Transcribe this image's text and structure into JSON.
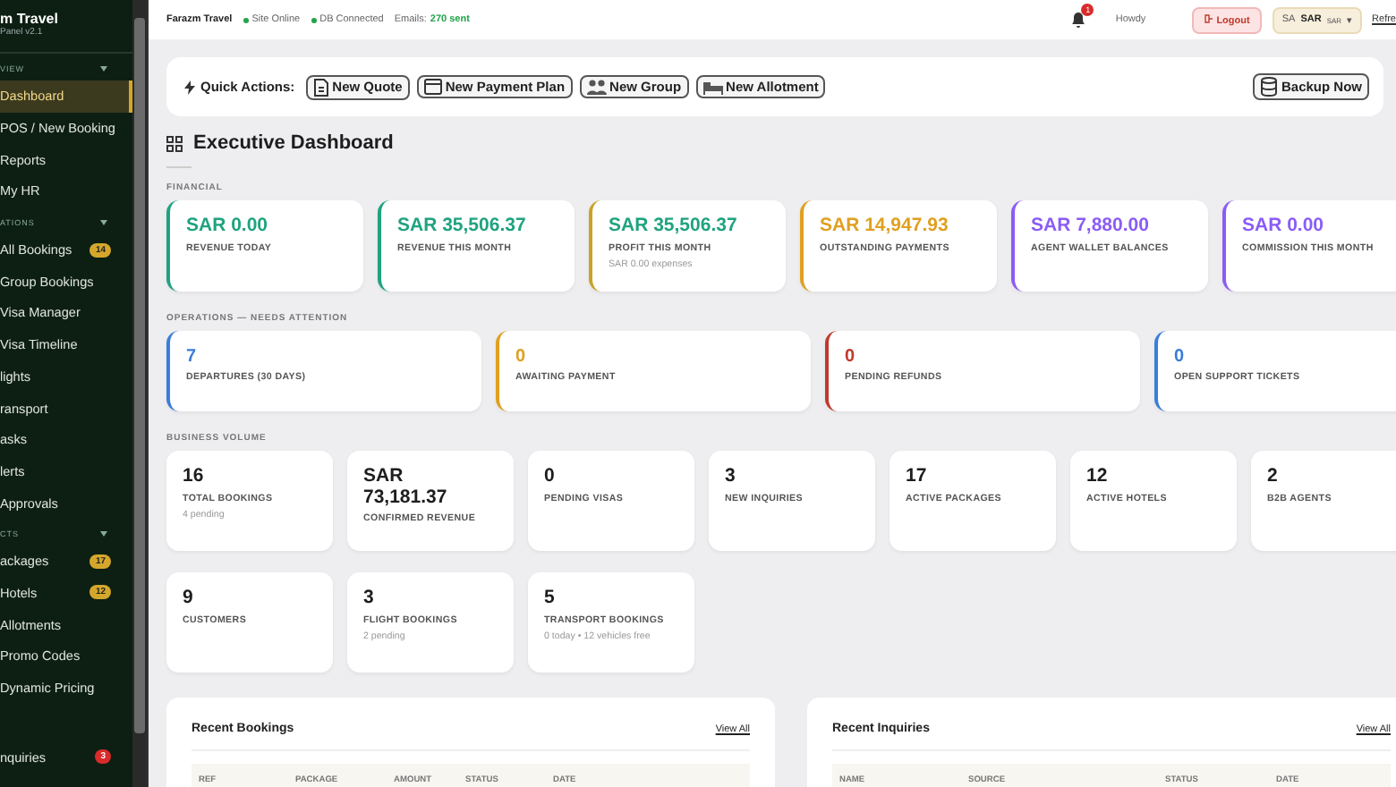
{
  "sidebar": {
    "brand": "m Travel",
    "subtitle": "Panel v2.1",
    "sections": [
      {
        "label": "VIEW",
        "items": [
          {
            "label": "Dashboard",
            "selected": true
          },
          {
            "label": "POS / New Booking",
            "selected": false
          },
          {
            "label": "Reports",
            "selected": false
          },
          {
            "label": "My HR",
            "selected": false
          }
        ]
      },
      {
        "label": "ATIONS",
        "items": [
          {
            "label": "All Bookings",
            "selected": false,
            "badge": "14",
            "color": "#d4a72c"
          },
          {
            "label": "Group Bookings",
            "selected": false
          },
          {
            "label": "Visa Manager",
            "selected": false
          },
          {
            "label": "Visa Timeline",
            "selected": false
          },
          {
            "label": "lights",
            "selected": false
          },
          {
            "label": "ransport",
            "selected": false
          },
          {
            "label": "asks",
            "selected": false
          },
          {
            "label": "lerts",
            "selected": false
          },
          {
            "label": "Approvals",
            "selected": false
          }
        ]
      },
      {
        "label": "CTS",
        "items": [
          {
            "label": "ackages",
            "selected": false,
            "badge": "17",
            "color": "#d4a72c"
          },
          {
            "label": "Hotels",
            "selected": false,
            "badge": "12",
            "color": "#d4a72c"
          },
          {
            "label": "Allotments",
            "selected": false
          },
          {
            "label": "Promo Codes",
            "selected": false
          },
          {
            "label": "Dynamic Pricing",
            "selected": false
          }
        ]
      },
      {
        "items": [
          {
            "label": "nquiries",
            "selected": false,
            "badge": "3",
            "color": "#d92b2b"
          }
        ]
      }
    ]
  },
  "topbar": {
    "site": "Farazm Travel",
    "statuses": [
      {
        "label": "Site Online",
        "color": "#22a34a"
      },
      {
        "label": "DB Connected",
        "color": "#22a34a"
      }
    ],
    "emails_label": "Emails:",
    "emails_value": "270 sent",
    "notifications": "1",
    "greeting": "Howdy",
    "logout": "Logout",
    "currency_code": "SA",
    "currency": "SAR",
    "currency_small": "SAR",
    "currency_caret": "▾",
    "refresh": "Refre"
  },
  "quick_actions": {
    "label": "Quick Actions:",
    "buttons": [
      "New Quote",
      "New Payment Plan",
      "New Group",
      "New Allotment"
    ],
    "backup": "Backup Now"
  },
  "title": "Executive Dashboard",
  "financial": {
    "label": "FINANCIAL",
    "cards": [
      {
        "value": {
          "text": "SAR 0.00",
          "color": "#1fa37f"
        },
        "label": "REVENUE TODAY",
        "color": "#1fa37f"
      },
      {
        "value": {
          "text": "SAR 35,506.37",
          "color": "#1fa37f"
        },
        "label": "REVENUE THIS MONTH",
        "color": "#1fa37f"
      },
      {
        "value": {
          "text": "SAR 35,506.37",
          "color": "#1fa37f"
        },
        "label": "PROFIT THIS MONTH",
        "note": "SAR 0.00 expenses",
        "color": "#c9a227"
      },
      {
        "value": {
          "text": "SAR 14,947.93",
          "color": "#e0a020"
        },
        "label": "OUTSTANDING PAYMENTS",
        "color": "#e0a020"
      },
      {
        "value": {
          "text": "SAR 7,880.00",
          "color": "#8b5cf6"
        },
        "label": "AGENT WALLET BALANCES",
        "color": "#8b5cf6"
      },
      {
        "value": {
          "text": "SAR 0.00",
          "color": "#8b5cf6"
        },
        "label": "COMMISSION THIS MONTH",
        "color": "#8b5cf6"
      }
    ]
  },
  "operations": {
    "label": "OPERATIONS — NEEDS ATTENTION",
    "cards": [
      {
        "value": "7",
        "label": "DEPARTURES (30 DAYS)",
        "color": "#3b7dd8"
      },
      {
        "value": "0",
        "label": "AWAITING PAYMENT",
        "color": "#e0a020"
      },
      {
        "value": "0",
        "label": "PENDING REFUNDS",
        "color": "#c0392b"
      },
      {
        "value": "0",
        "label": "OPEN SUPPORT TICKETS",
        "color": "#3b7dd8"
      }
    ]
  },
  "business_volume": {
    "label": "BUSINESS VOLUME",
    "cards": [
      {
        "value": "16",
        "label": "TOTAL BOOKINGS",
        "note": "4 pending"
      },
      {
        "value": "SAR 73,181.37",
        "label": "CONFIRMED REVENUE"
      },
      {
        "value": "0",
        "label": "PENDING VISAS"
      },
      {
        "value": "3",
        "label": "NEW INQUIRIES"
      },
      {
        "value": "17",
        "label": "ACTIVE PACKAGES"
      },
      {
        "value": "12",
        "label": "ACTIVE HOTELS"
      },
      {
        "value": "2",
        "label": "B2B AGENTS"
      },
      {
        "value": "9",
        "label": "CUSTOMERS"
      },
      {
        "value": "3",
        "label": "FLIGHT BOOKINGS",
        "note": "2 pending"
      },
      {
        "value": "5",
        "label": "TRANSPORT BOOKINGS",
        "note": "0 today • 12 vehicles free"
      }
    ]
  },
  "panels": [
    {
      "title": "Recent Bookings",
      "link": "View All",
      "columns": [
        "REF",
        "PACKAGE",
        "AMOUNT",
        "STATUS",
        "DATE"
      ]
    },
    {
      "title": "Recent Inquiries",
      "link": "View All",
      "columns": [
        "NAME",
        "SOURCE",
        "STATUS",
        "DATE"
      ]
    }
  ]
}
